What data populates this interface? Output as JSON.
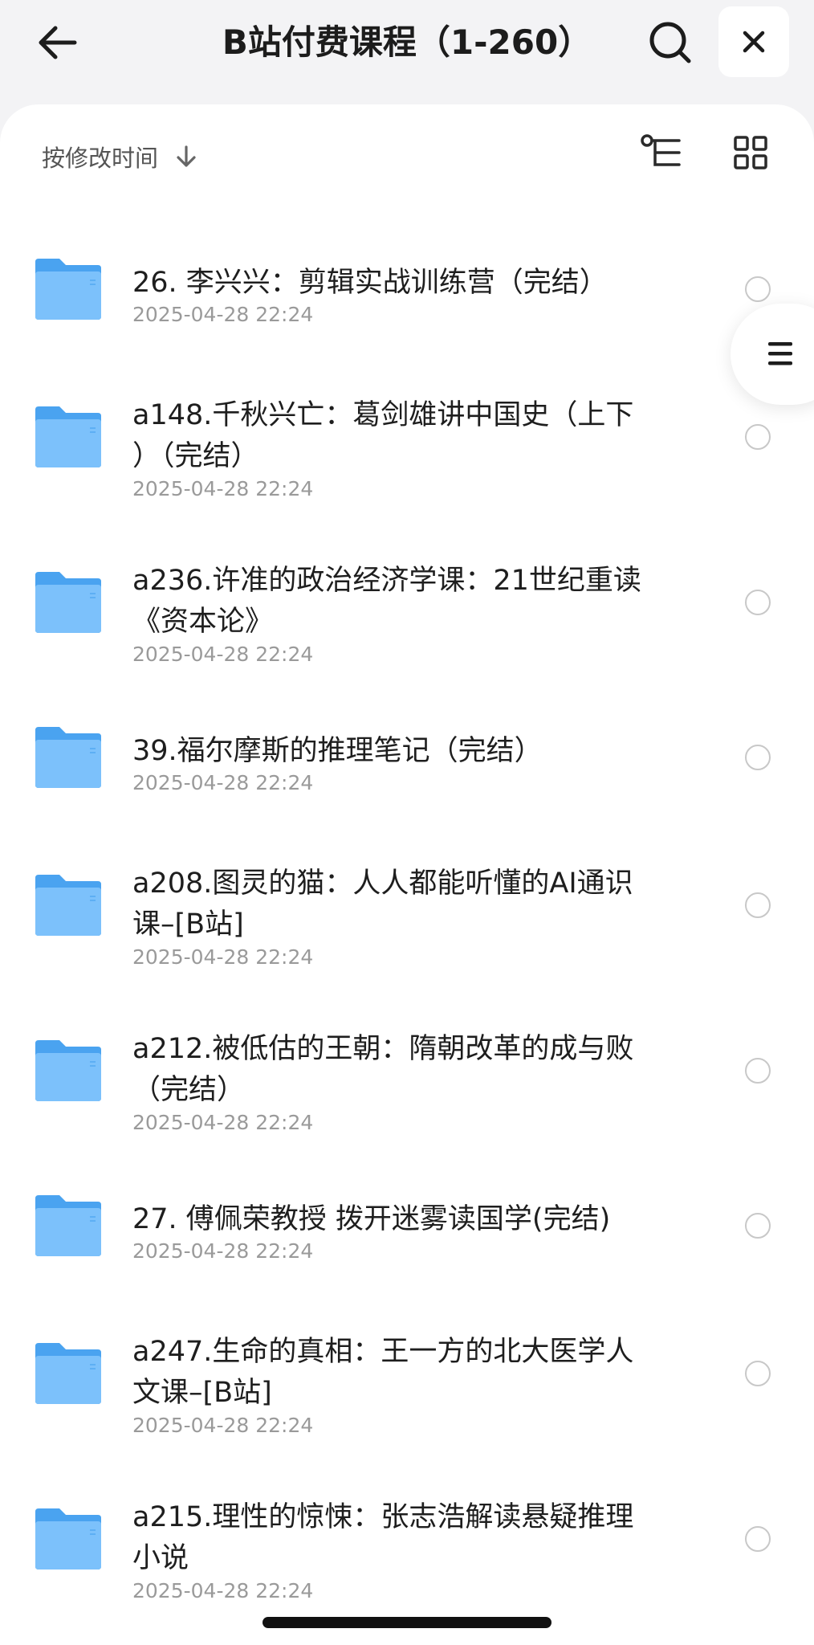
{
  "header": {
    "title": "B站付费课程（1-260）",
    "back_icon": "arrow-left-icon",
    "search_icon": "search-icon",
    "close_icon": "close-icon"
  },
  "toolbar": {
    "sort_label": "按修改时间",
    "sort_icon": "arrow-down-icon",
    "tree_view_icon": "tree-view-icon",
    "grid_view_icon": "grid-view-icon"
  },
  "files": [
    {
      "line1": "26. 李兴兴：剪辑实战训练营（完结）",
      "line2": "",
      "modified": "2025-04-28 22:24"
    },
    {
      "line1": "a148.千秋兴亡：葛剑雄讲中国史（上下",
      "line2": "）（完结）",
      "modified": "2025-04-28 22:24"
    },
    {
      "line1": "a236.许准的政治经济学课：21世纪重读",
      "line2": "《资本论》",
      "modified": "2025-04-28 22:24"
    },
    {
      "line1": "39.福尔摩斯的推理笔记（完结）",
      "line2": "",
      "modified": "2025-04-28 22:24"
    },
    {
      "line1": "a208.图灵的猫：人人都能听懂的AI通识",
      "line2": "课–[B站]",
      "modified": "2025-04-28 22:24"
    },
    {
      "line1": "a212.被低估的王朝：隋朝改革的成与败",
      "line2": "（完结）",
      "modified": "2025-04-28 22:24"
    },
    {
      "line1": "27. 傅佩荣教授 拨开迷雾读国学(完结)",
      "line2": "",
      "modified": "2025-04-28 22:24"
    },
    {
      "line1": "a247.生命的真相：王一方的北大医学人",
      "line2": "文课–[B站]",
      "modified": "2025-04-28 22:24"
    },
    {
      "line1": "a215.理性的惊悚：张志浩解读悬疑推理",
      "line2": "小说",
      "modified": "2025-04-28 22:24"
    }
  ],
  "colors": {
    "folder_back": "#4aa3f0",
    "folder_front": "#7cc1fb",
    "background": "#f3f3f5",
    "sheet": "#ffffff"
  }
}
